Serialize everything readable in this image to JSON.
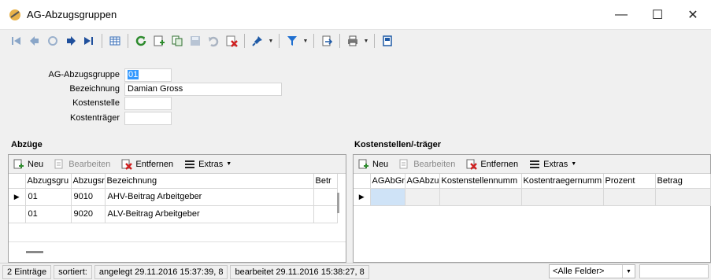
{
  "window": {
    "title": "AG-Abzugsgruppen",
    "minimize": "—",
    "maximize": "☐",
    "close": "✕"
  },
  "toolbar": {
    "icons": [
      "first-record-icon",
      "prev-record-icon",
      "prev-disabled-icon",
      "next-record-icon",
      "last-record-icon",
      "table-view-icon",
      "refresh-icon",
      "new-record-icon",
      "copy-record-icon",
      "save-icon",
      "undo-icon",
      "delete-icon",
      "pin-icon",
      "filter-icon",
      "export-icon",
      "print-icon",
      "view-icon"
    ]
  },
  "form": {
    "gruppe_label": "AG-Abzugsgruppe",
    "gruppe_value": "01",
    "bezeichnung_label": "Bezeichnung",
    "bezeichnung_value": "Damian Gross",
    "kostenstelle_label": "Kostenstelle",
    "kostenstelle_value": "",
    "kostentraeger_label": "Kostenträger",
    "kostentraeger_value": ""
  },
  "abzuege": {
    "title": "Abzüge",
    "btn_neu": "Neu",
    "btn_bearbeiten": "Bearbeiten",
    "btn_entfernen": "Entfernen",
    "btn_extras": "Extras",
    "columns": [
      "Abzugsgru",
      "Abzugsr",
      "Bezeichnung",
      "Betr"
    ],
    "rows": [
      [
        "01",
        "9010",
        "AHV-Beitrag Arbeitgeber",
        ""
      ],
      [
        "01",
        "9020",
        "ALV-Beitrag Arbeitgeber",
        ""
      ]
    ]
  },
  "kosten": {
    "title": "Kostenstellen/-träger",
    "btn_neu": "Neu",
    "btn_bearbeiten": "Bearbeiten",
    "btn_entfernen": "Entfernen",
    "btn_extras": "Extras",
    "columns": [
      "AGAbGr",
      "AGAbzu",
      "Kostenstellennumm",
      "Kostentraegernumm",
      "Prozent",
      "Betrag"
    ]
  },
  "status": {
    "count": "2 Einträge",
    "sorted": "sortiert:",
    "created": "angelegt 29.11.2016 15:37:39,  8",
    "edited": "bearbeitet 29.11.2016 15:38:27,  8",
    "field_filter": "<Alle Felder>"
  }
}
